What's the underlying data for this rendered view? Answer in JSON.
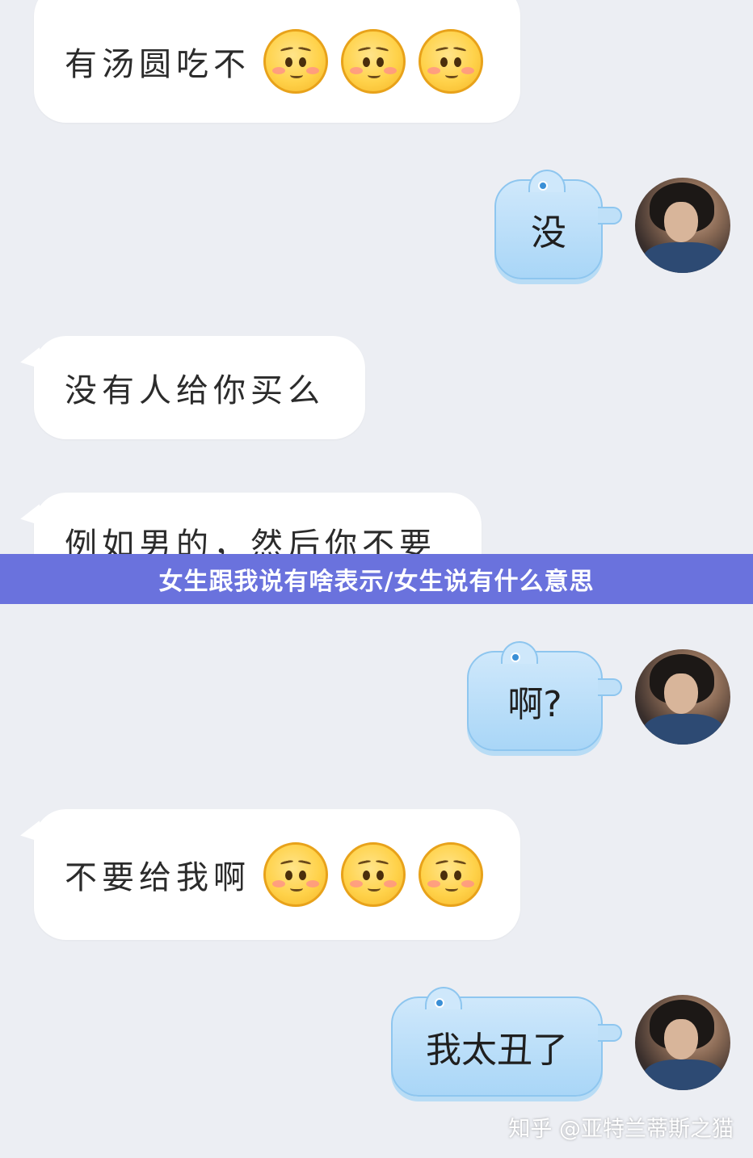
{
  "banner": {
    "title": "女生跟我说有啥表示/女生说有什么意思"
  },
  "messages": [
    {
      "side": "incoming",
      "text": "有汤圆吃不",
      "emoji": [
        "pleading-face",
        "pleading-face",
        "pleading-face"
      ]
    },
    {
      "side": "outgoing",
      "text": "没"
    },
    {
      "side": "incoming",
      "text": "没有人给你买么"
    },
    {
      "side": "incoming",
      "text": "例如男的，然后你不要"
    },
    {
      "side": "outgoing",
      "text": "啊?"
    },
    {
      "side": "incoming",
      "text": "不要给我啊",
      "emoji": [
        "pleading-face",
        "pleading-face",
        "pleading-face"
      ]
    },
    {
      "side": "outgoing",
      "text": "我太丑了"
    }
  ],
  "watermark": "知乎 @亚特兰蒂斯之猫",
  "colors": {
    "background": "#eceef3",
    "incoming_bubble": "#ffffff",
    "outgoing_bubble": "#a9d6f7",
    "banner": "#6a72dd"
  }
}
